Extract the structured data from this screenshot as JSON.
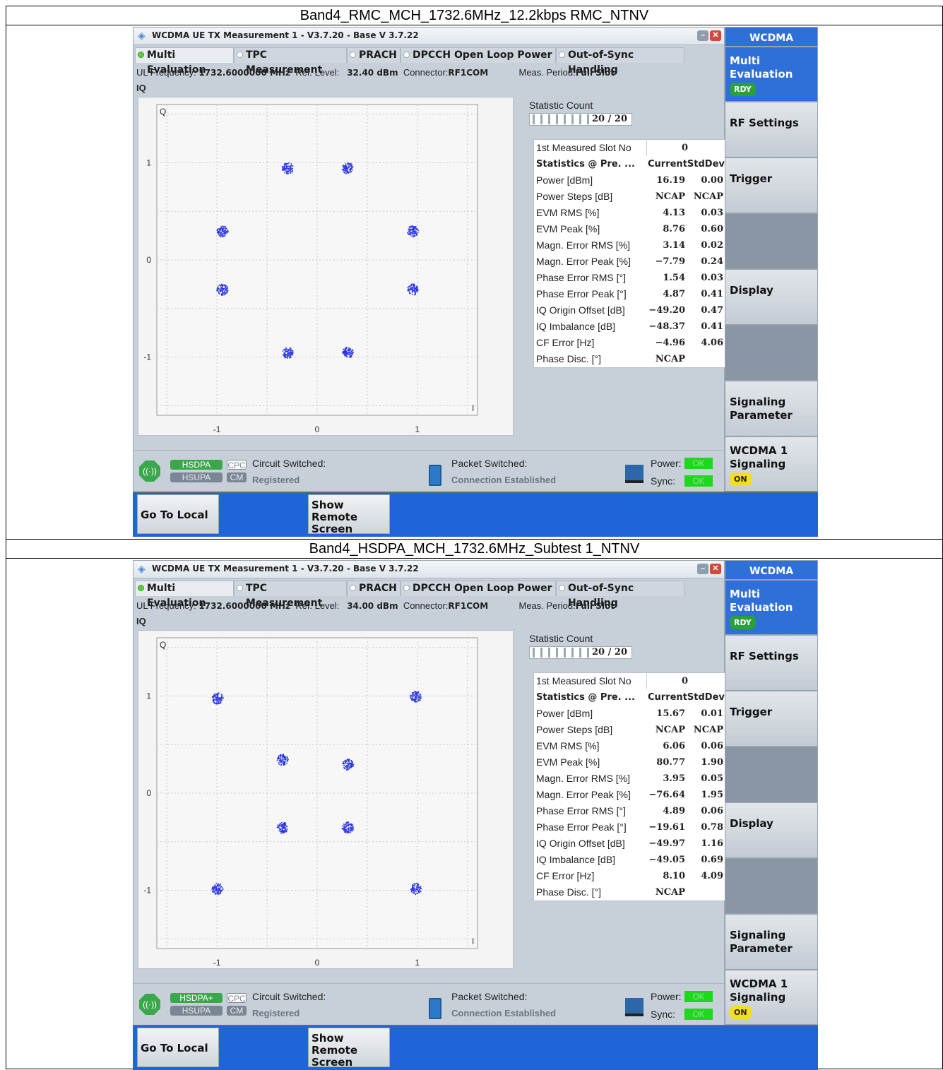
{
  "colors": {
    "accent": "#1f64d8",
    "ok_green": "#1ed81e",
    "dot_blue": "#2834e6"
  },
  "panels": [
    {
      "caption": "Band4_RMC_MCH_1732.6MHz_12.2kbps RMC_NTNV",
      "window_title": "WCDMA UE TX Measurement 1 - V3.7.20 - Base V 3.7.22",
      "tabs": [
        "Multi Evaluation",
        "TPC Measurement",
        "PRACH",
        "DPCCH Open Loop Power",
        "Out-of-Sync Handling"
      ],
      "ul_freq_label": "UL Frequency:",
      "ul_freq_value": "1732.6000000 MHz",
      "ref_level_label": "Ref. Level:",
      "ref_level_value": "32.40 dBm",
      "connector_label": "Connector:",
      "connector_value": "RF1COM",
      "meas_period_label": "Meas. Period:",
      "meas_period_value": "Full Slot",
      "iq_label": "IQ",
      "stat_count_label": "Statistic Count",
      "stat_count_value": "20 / 20",
      "first_slot_label": "1st Measured Slot No",
      "first_slot_value": "0",
      "stats_header_label": "Statistics @ Pre. ...",
      "stats_header_cols": "CurrentStdDev",
      "rows": [
        {
          "label": "Power [dBm]",
          "cur": "16.19",
          "std": "0.00"
        },
        {
          "label": "Power Steps [dB]",
          "cur": "NCAP",
          "std": "NCAP"
        },
        {
          "label": "EVM RMS [%]",
          "cur": "4.13",
          "std": "0.03"
        },
        {
          "label": "EVM Peak [%]",
          "cur": "8.76",
          "std": "0.60"
        },
        {
          "label": "Magn. Error RMS [%]",
          "cur": "3.14",
          "std": "0.02"
        },
        {
          "label": "Magn. Error Peak [%]",
          "cur": "−7.79",
          "std": "0.24"
        },
        {
          "label": "Phase Error RMS [°]",
          "cur": "1.54",
          "std": "0.03"
        },
        {
          "label": "Phase Error Peak [°]",
          "cur": "4.87",
          "std": "0.41"
        },
        {
          "label": "IQ Origin Offset [dB]",
          "cur": "−49.20",
          "std": "0.47"
        },
        {
          "label": "IQ Imbalance [dB]",
          "cur": "−48.37",
          "std": "0.41"
        },
        {
          "label": "CF Error [Hz]",
          "cur": "−4.96",
          "std": "4.06"
        },
        {
          "label": "Phase Disc. [°]",
          "cur": "NCAP",
          "std": ""
        }
      ],
      "chart_data": {
        "type": "scatter",
        "xlabel": "I",
        "ylabel": "Q",
        "xlim": [
          -1.6,
          1.6
        ],
        "ylim": [
          -1.6,
          1.6
        ],
        "xticks": [
          "-1",
          "0",
          "1"
        ],
        "yticks": [
          "1",
          "0",
          "-1"
        ],
        "grid": true,
        "clusters": [
          {
            "x": -0.3,
            "y": 0.95
          },
          {
            "x": 0.3,
            "y": 0.95
          },
          {
            "x": -0.95,
            "y": 0.3
          },
          {
            "x": 0.95,
            "y": 0.3
          },
          {
            "x": -0.95,
            "y": -0.3
          },
          {
            "x": 0.95,
            "y": -0.3
          },
          {
            "x": -0.3,
            "y": -0.95
          },
          {
            "x": 0.3,
            "y": -0.95
          }
        ]
      },
      "status": {
        "hsdpa": "HSDPA",
        "hsupa": "HSUPA",
        "cpc": "CPC",
        "cm": "CM",
        "circuit_label": "Circuit Switched:",
        "circuit_state": "Registered",
        "packet_label": "Packet Switched:",
        "packet_state": "Connection Established",
        "power_label": "Power:",
        "sync_label": "Sync:",
        "ok": "OK"
      }
    },
    {
      "caption": "Band4_HSDPA_MCH_1732.6MHz_Subtest 1_NTNV",
      "window_title": "WCDMA UE TX Measurement 1 - V3.7.20 - Base V 3.7.22",
      "tabs": [
        "Multi Evaluation",
        "TPC Measurement",
        "PRACH",
        "DPCCH Open Loop Power",
        "Out-of-Sync Handling"
      ],
      "ul_freq_label": "UL Frequency:",
      "ul_freq_value": "1732.6000000 MHz",
      "ref_level_label": "Ref. Level:",
      "ref_level_value": "34.00 dBm",
      "connector_label": "Connector:",
      "connector_value": "RF1COM",
      "meas_period_label": "Meas. Period:",
      "meas_period_value": "Full Slot",
      "iq_label": "IQ",
      "stat_count_label": "Statistic Count",
      "stat_count_value": "20 / 20",
      "first_slot_label": "1st Measured Slot No",
      "first_slot_value": "0",
      "stats_header_label": "Statistics @ Pre. ...",
      "stats_header_cols": "CurrentStdDev",
      "rows": [
        {
          "label": "Power [dBm]",
          "cur": "15.67",
          "std": "0.01"
        },
        {
          "label": "Power Steps [dB]",
          "cur": "NCAP",
          "std": "NCAP"
        },
        {
          "label": "EVM RMS [%]",
          "cur": "6.06",
          "std": "0.06"
        },
        {
          "label": "EVM Peak [%]",
          "cur": "80.77",
          "std": "1.90"
        },
        {
          "label": "Magn. Error RMS [%]",
          "cur": "3.95",
          "std": "0.05"
        },
        {
          "label": "Magn. Error Peak [%]",
          "cur": "−76.64",
          "std": "1.95"
        },
        {
          "label": "Phase Error RMS [°]",
          "cur": "4.89",
          "std": "0.06"
        },
        {
          "label": "Phase Error Peak [°]",
          "cur": "−19.61",
          "std": "0.78"
        },
        {
          "label": "IQ Origin Offset [dB]",
          "cur": "−49.97",
          "std": "1.16"
        },
        {
          "label": "IQ Imbalance [dB]",
          "cur": "−49.05",
          "std": "0.69"
        },
        {
          "label": "CF Error [Hz]",
          "cur": "8.10",
          "std": "4.09"
        },
        {
          "label": "Phase Disc. [°]",
          "cur": "NCAP",
          "std": ""
        }
      ],
      "chart_data": {
        "type": "scatter",
        "xlabel": "I",
        "ylabel": "Q",
        "xlim": [
          -1.6,
          1.6
        ],
        "ylim": [
          -1.6,
          1.6
        ],
        "xticks": [
          "-1",
          "0",
          "1"
        ],
        "yticks": [
          "1",
          "0",
          "-1"
        ],
        "grid": true,
        "clusters": [
          {
            "x": -1.0,
            "y": 0.98
          },
          {
            "x": 0.98,
            "y": 1.0
          },
          {
            "x": -0.35,
            "y": 0.35
          },
          {
            "x": 0.3,
            "y": 0.3
          },
          {
            "x": -0.35,
            "y": -0.35
          },
          {
            "x": 0.3,
            "y": -0.35
          },
          {
            "x": -1.0,
            "y": -0.98
          },
          {
            "x": 0.98,
            "y": -0.98
          }
        ]
      },
      "status": {
        "hsdpa": "HSDPA+",
        "hsupa": "HSUPA",
        "cpc": "CPC",
        "cm": "CM",
        "circuit_label": "Circuit Switched:",
        "circuit_state": "Registered",
        "packet_label": "Packet Switched:",
        "packet_state": "Connection Established",
        "power_label": "Power:",
        "sync_label": "Sync:",
        "ok": "OK"
      }
    }
  ],
  "softkeys": {
    "header": "WCDMA",
    "multi_eval": "Multi Evaluation",
    "rdy": "RDY",
    "rf_settings": "RF Settings",
    "trigger": "Trigger",
    "display": "Display",
    "signaling_param": "Signaling Parameter",
    "wcdma_signaling": "WCDMA 1 Signaling",
    "on": "ON"
  },
  "hotkeys": {
    "go_local": "Go To Local",
    "show_remote": "Show Remote Screen"
  }
}
